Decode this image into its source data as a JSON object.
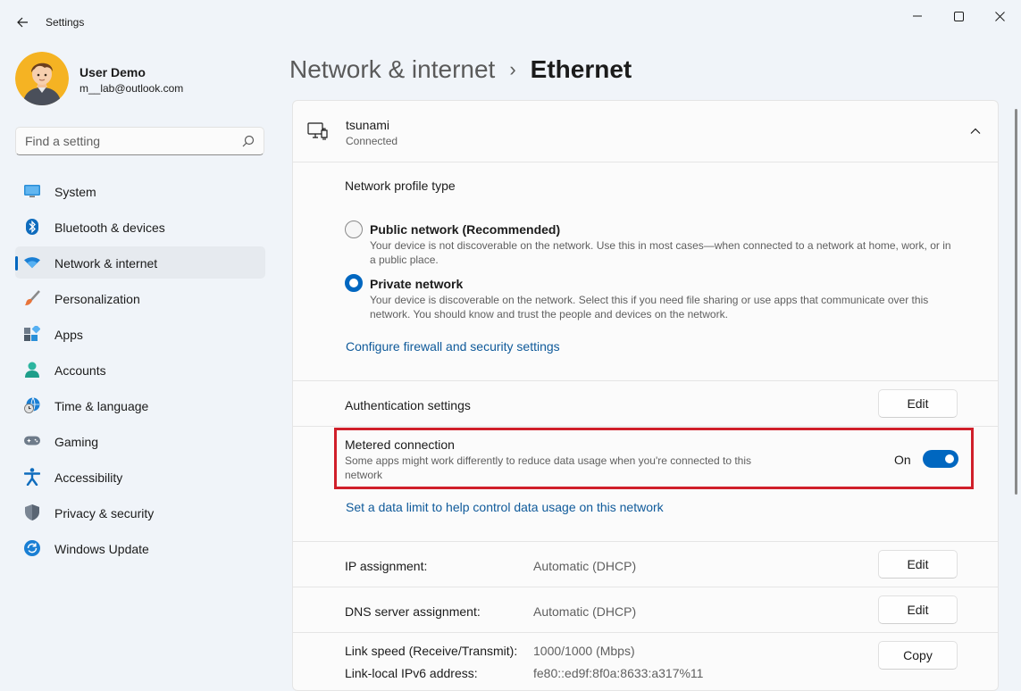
{
  "window": {
    "title": "Settings"
  },
  "user": {
    "name": "User Demo",
    "email": "m__lab@outlook.com"
  },
  "search": {
    "placeholder": "Find a setting"
  },
  "sidebar": {
    "items": [
      {
        "label": "System",
        "icon": "monitor-icon"
      },
      {
        "label": "Bluetooth & devices",
        "icon": "bluetooth-icon"
      },
      {
        "label": "Network & internet",
        "icon": "wifi-icon",
        "active": true
      },
      {
        "label": "Personalization",
        "icon": "brush-icon"
      },
      {
        "label": "Apps",
        "icon": "apps-icon"
      },
      {
        "label": "Accounts",
        "icon": "person-icon"
      },
      {
        "label": "Time & language",
        "icon": "globe-clock-icon"
      },
      {
        "label": "Gaming",
        "icon": "gamepad-icon"
      },
      {
        "label": "Accessibility",
        "icon": "accessibility-icon"
      },
      {
        "label": "Privacy & security",
        "icon": "shield-icon"
      },
      {
        "label": "Windows Update",
        "icon": "update-icon"
      }
    ]
  },
  "header": {
    "parent": "Network & internet",
    "separator": "›",
    "current": "Ethernet"
  },
  "ethernet": {
    "name": "tsunami",
    "status": "Connected"
  },
  "profile": {
    "heading": "Network profile type",
    "public_title": "Public network (Recommended)",
    "public_desc": "Your device is not discoverable on the network. Use this in most cases—when connected to a network at home, work, or in a public place.",
    "private_title": "Private network",
    "private_desc": "Your device is discoverable on the network. Select this if you need file sharing or use apps that communicate over this network. You should know and trust the people and devices on the network.",
    "selected": "private",
    "firewall_link": "Configure firewall and security settings"
  },
  "auth": {
    "label": "Authentication settings",
    "button": "Edit"
  },
  "metered": {
    "title": "Metered connection",
    "desc": "Some apps might work differently to reduce data usage when you're connected to this network",
    "state_label": "On",
    "enabled": true,
    "data_limit_link": "Set a data limit to help control data usage on this network"
  },
  "ip": {
    "label": "IP assignment:",
    "value": "Automatic (DHCP)",
    "button": "Edit"
  },
  "dns": {
    "label": "DNS server assignment:",
    "value": "Automatic (DHCP)",
    "button": "Edit"
  },
  "props": {
    "link_speed_label": "Link speed (Receive/Transmit):",
    "link_speed_value": "1000/1000 (Mbps)",
    "ipv6_label": "Link-local IPv6 address:",
    "ipv6_value": "fe80::ed9f:8f0a:8633:a317%11",
    "button": "Copy"
  },
  "colors": {
    "accent": "#0067c0",
    "highlight": "#d01f2a",
    "background": "#f0f4f9"
  }
}
